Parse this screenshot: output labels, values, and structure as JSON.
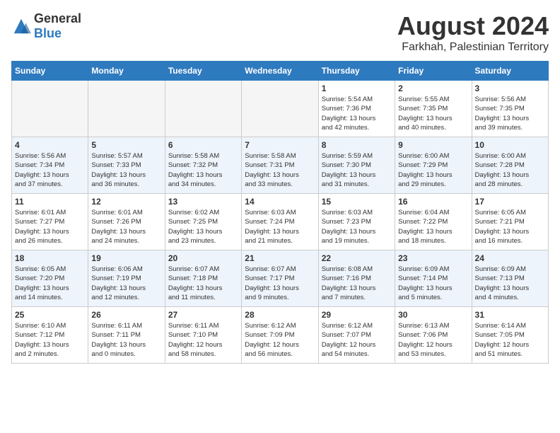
{
  "header": {
    "logo_general": "General",
    "logo_blue": "Blue",
    "month_year": "August 2024",
    "location": "Farkhah, Palestinian Territory"
  },
  "weekdays": [
    "Sunday",
    "Monday",
    "Tuesday",
    "Wednesday",
    "Thursday",
    "Friday",
    "Saturday"
  ],
  "weeks": [
    [
      {
        "day": "",
        "info": ""
      },
      {
        "day": "",
        "info": ""
      },
      {
        "day": "",
        "info": ""
      },
      {
        "day": "",
        "info": ""
      },
      {
        "day": "1",
        "info": "Sunrise: 5:54 AM\nSunset: 7:36 PM\nDaylight: 13 hours\nand 42 minutes."
      },
      {
        "day": "2",
        "info": "Sunrise: 5:55 AM\nSunset: 7:35 PM\nDaylight: 13 hours\nand 40 minutes."
      },
      {
        "day": "3",
        "info": "Sunrise: 5:56 AM\nSunset: 7:35 PM\nDaylight: 13 hours\nand 39 minutes."
      }
    ],
    [
      {
        "day": "4",
        "info": "Sunrise: 5:56 AM\nSunset: 7:34 PM\nDaylight: 13 hours\nand 37 minutes."
      },
      {
        "day": "5",
        "info": "Sunrise: 5:57 AM\nSunset: 7:33 PM\nDaylight: 13 hours\nand 36 minutes."
      },
      {
        "day": "6",
        "info": "Sunrise: 5:58 AM\nSunset: 7:32 PM\nDaylight: 13 hours\nand 34 minutes."
      },
      {
        "day": "7",
        "info": "Sunrise: 5:58 AM\nSunset: 7:31 PM\nDaylight: 13 hours\nand 33 minutes."
      },
      {
        "day": "8",
        "info": "Sunrise: 5:59 AM\nSunset: 7:30 PM\nDaylight: 13 hours\nand 31 minutes."
      },
      {
        "day": "9",
        "info": "Sunrise: 6:00 AM\nSunset: 7:29 PM\nDaylight: 13 hours\nand 29 minutes."
      },
      {
        "day": "10",
        "info": "Sunrise: 6:00 AM\nSunset: 7:28 PM\nDaylight: 13 hours\nand 28 minutes."
      }
    ],
    [
      {
        "day": "11",
        "info": "Sunrise: 6:01 AM\nSunset: 7:27 PM\nDaylight: 13 hours\nand 26 minutes."
      },
      {
        "day": "12",
        "info": "Sunrise: 6:01 AM\nSunset: 7:26 PM\nDaylight: 13 hours\nand 24 minutes."
      },
      {
        "day": "13",
        "info": "Sunrise: 6:02 AM\nSunset: 7:25 PM\nDaylight: 13 hours\nand 23 minutes."
      },
      {
        "day": "14",
        "info": "Sunrise: 6:03 AM\nSunset: 7:24 PM\nDaylight: 13 hours\nand 21 minutes."
      },
      {
        "day": "15",
        "info": "Sunrise: 6:03 AM\nSunset: 7:23 PM\nDaylight: 13 hours\nand 19 minutes."
      },
      {
        "day": "16",
        "info": "Sunrise: 6:04 AM\nSunset: 7:22 PM\nDaylight: 13 hours\nand 18 minutes."
      },
      {
        "day": "17",
        "info": "Sunrise: 6:05 AM\nSunset: 7:21 PM\nDaylight: 13 hours\nand 16 minutes."
      }
    ],
    [
      {
        "day": "18",
        "info": "Sunrise: 6:05 AM\nSunset: 7:20 PM\nDaylight: 13 hours\nand 14 minutes."
      },
      {
        "day": "19",
        "info": "Sunrise: 6:06 AM\nSunset: 7:19 PM\nDaylight: 13 hours\nand 12 minutes."
      },
      {
        "day": "20",
        "info": "Sunrise: 6:07 AM\nSunset: 7:18 PM\nDaylight: 13 hours\nand 11 minutes."
      },
      {
        "day": "21",
        "info": "Sunrise: 6:07 AM\nSunset: 7:17 PM\nDaylight: 13 hours\nand 9 minutes."
      },
      {
        "day": "22",
        "info": "Sunrise: 6:08 AM\nSunset: 7:16 PM\nDaylight: 13 hours\nand 7 minutes."
      },
      {
        "day": "23",
        "info": "Sunrise: 6:09 AM\nSunset: 7:14 PM\nDaylight: 13 hours\nand 5 minutes."
      },
      {
        "day": "24",
        "info": "Sunrise: 6:09 AM\nSunset: 7:13 PM\nDaylight: 13 hours\nand 4 minutes."
      }
    ],
    [
      {
        "day": "25",
        "info": "Sunrise: 6:10 AM\nSunset: 7:12 PM\nDaylight: 13 hours\nand 2 minutes."
      },
      {
        "day": "26",
        "info": "Sunrise: 6:11 AM\nSunset: 7:11 PM\nDaylight: 13 hours\nand 0 minutes."
      },
      {
        "day": "27",
        "info": "Sunrise: 6:11 AM\nSunset: 7:10 PM\nDaylight: 12 hours\nand 58 minutes."
      },
      {
        "day": "28",
        "info": "Sunrise: 6:12 AM\nSunset: 7:09 PM\nDaylight: 12 hours\nand 56 minutes."
      },
      {
        "day": "29",
        "info": "Sunrise: 6:12 AM\nSunset: 7:07 PM\nDaylight: 12 hours\nand 54 minutes."
      },
      {
        "day": "30",
        "info": "Sunrise: 6:13 AM\nSunset: 7:06 PM\nDaylight: 12 hours\nand 53 minutes."
      },
      {
        "day": "31",
        "info": "Sunrise: 6:14 AM\nSunset: 7:05 PM\nDaylight: 12 hours\nand 51 minutes."
      }
    ]
  ]
}
